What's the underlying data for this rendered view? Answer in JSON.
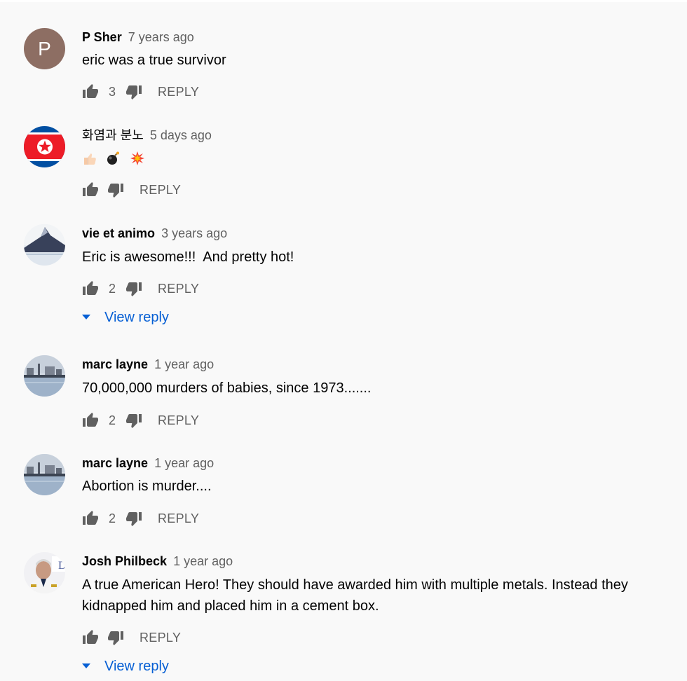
{
  "actions": {
    "reply_label": "REPLY",
    "view_reply_label": "View reply"
  },
  "colors": {
    "background": "#f9f9f9",
    "author": "#030303",
    "secondary": "#606060",
    "link": "#065fd4"
  },
  "comments": [
    {
      "author": "P Sher",
      "time": "7 years ago",
      "text": "eric was a true survivor",
      "likes": "3",
      "avatar": {
        "type": "letter",
        "letter": "P",
        "color": "#8d6e63"
      },
      "has_view_reply": false
    },
    {
      "author": "화염과 분노",
      "time": "5 days ago",
      "text": "",
      "emoji": [
        "thumbs-up-emoji",
        "bomb-emoji",
        "collision-emoji"
      ],
      "likes": "",
      "avatar": {
        "type": "flag",
        "icon": "north-korea-flag-icon"
      },
      "has_view_reply": false
    },
    {
      "author": "vie et animo",
      "time": "3 years ago",
      "text": "Eric is awesome!!!  And pretty hot!",
      "likes": "2",
      "avatar": {
        "type": "photo",
        "icon": "mountain-photo-icon"
      },
      "has_view_reply": true
    },
    {
      "author": "marc layne",
      "time": "1 year ago",
      "text": "70,000,000 murders of babies, since 1973.......",
      "likes": "2",
      "avatar": {
        "type": "photo",
        "icon": "harbor-photo-icon"
      },
      "has_view_reply": false
    },
    {
      "author": "marc layne",
      "time": "1 year ago",
      "text": "Abortion is murder....",
      "likes": "2",
      "avatar": {
        "type": "photo",
        "icon": "harbor-photo-icon"
      },
      "has_view_reply": false
    },
    {
      "author": "Josh Philbeck",
      "time": "1 year ago",
      "text_lines": [
        "A true American Hero! They should have awarded him with multiple metals. Instead they",
        "kidnapped him and placed him in a cement box."
      ],
      "likes": "",
      "avatar": {
        "type": "photo",
        "icon": "man-portrait-icon"
      },
      "has_view_reply": true
    }
  ]
}
